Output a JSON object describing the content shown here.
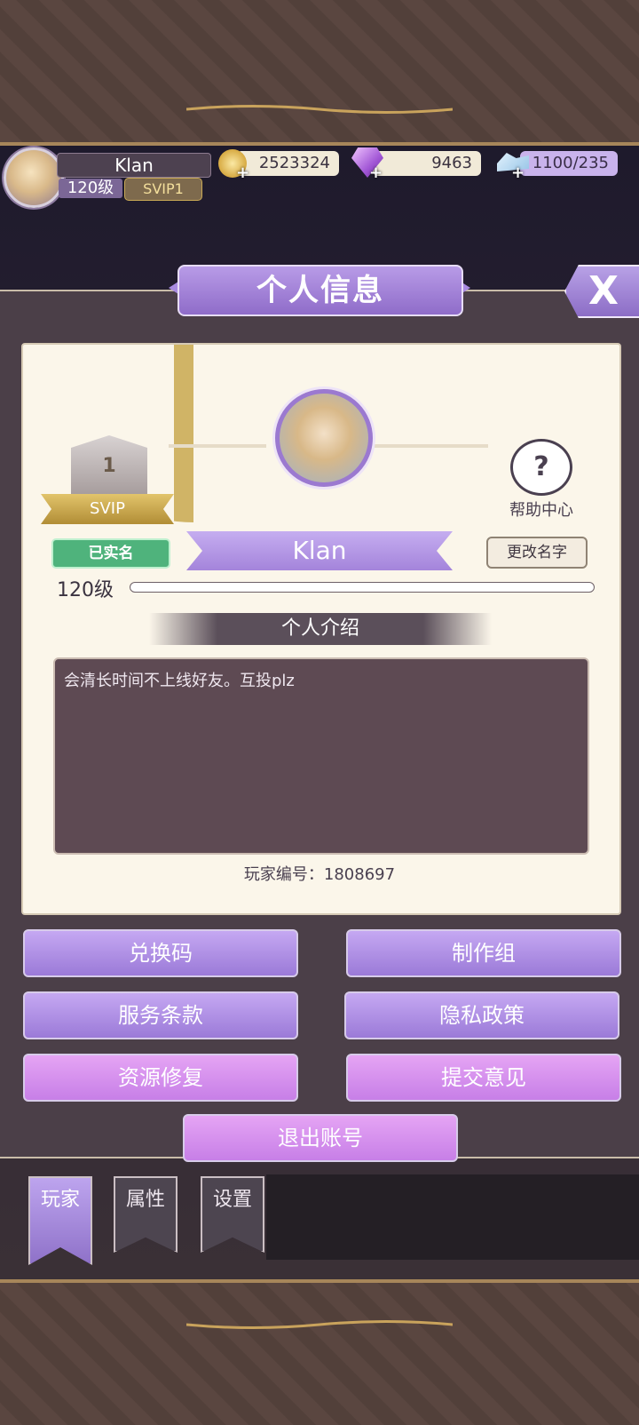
{
  "topbar": {
    "player_name": "Klan",
    "level": "120级",
    "svip": "SVIP1",
    "coins": "2523324",
    "gems": "9463",
    "stamina": "1100/235"
  },
  "dialog": {
    "title": "个人信息",
    "close_label": "X"
  },
  "profile": {
    "vip_rank": "1",
    "vip_label": "SVIP",
    "help_label": "帮助中心",
    "help_icon": "?",
    "verified_label": "已实名",
    "name": "Klan",
    "rename_button": "更改名字",
    "level_label": "120级",
    "intro_heading": "个人介绍",
    "intro_text": "会清长时间不上线好友。互投plz",
    "player_id": "玩家编号：1808697"
  },
  "actions": {
    "redeem_code": "兑换码",
    "credits": "制作组",
    "terms": "服务条款",
    "privacy": "隐私政策",
    "repair": "资源修复",
    "feedback": "提交意见",
    "logout": "退出账号"
  },
  "tabs": [
    {
      "label": "玩家",
      "active": true
    },
    {
      "label": "属性",
      "active": false
    },
    {
      "label": "设置",
      "active": false
    }
  ],
  "colors": {
    "accent_purple": "#a484db",
    "accent_pink": "#d58cec",
    "panel": "#4b3f48",
    "card": "#fbf6ea"
  }
}
